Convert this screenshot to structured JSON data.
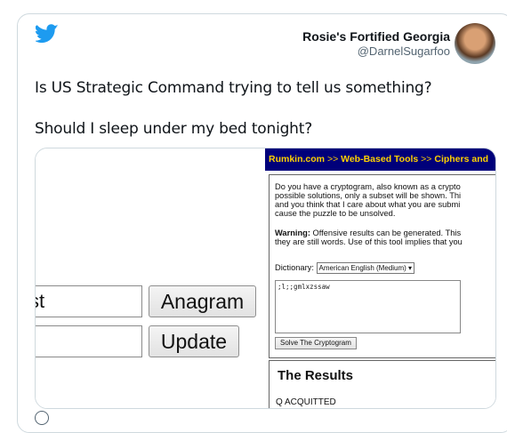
{
  "tweet": {
    "author_name": "Rosie's Fortified Georgia",
    "author_handle": "@DarnelSugarfoo",
    "line1": "Is US Strategic Command trying to tell us something?",
    "line2": "Should I sleep under my bed tonight?"
  },
  "media": {
    "left": {
      "input1_value": "st",
      "anagram_label": "Anagram",
      "update_label": "Update"
    },
    "right": {
      "breadcrumb": [
        "Rumkin.com",
        "Web-Based Tools",
        "Ciphers and"
      ],
      "breadcrumb_sep": ">>",
      "intro_lines": [
        "Do you have a cryptogram, also known as a crypto",
        "possible solutions, only a subset will be shown. Thi",
        "and you think that I care about what you are submi",
        "cause the puzzle to be unsolved."
      ],
      "warning_label": "Warning:",
      "warning_line1": "Offensive results can be generated. This",
      "warning_line2": "they are still words. Use of this tool implies that you",
      "dictionary_label": "Dictionary:",
      "dictionary_value": "American English (Medium)",
      "textarea_value": ";l;;gmlxzssaw",
      "solve_label": "Solve The Cryptogram",
      "results_title": "The Results",
      "results_first": "Q ACQUITTED"
    }
  },
  "colors": {
    "topbar_bg": "#00007a",
    "topbar_text": "#ffd200",
    "twitter_blue": "#1d9bf0"
  }
}
